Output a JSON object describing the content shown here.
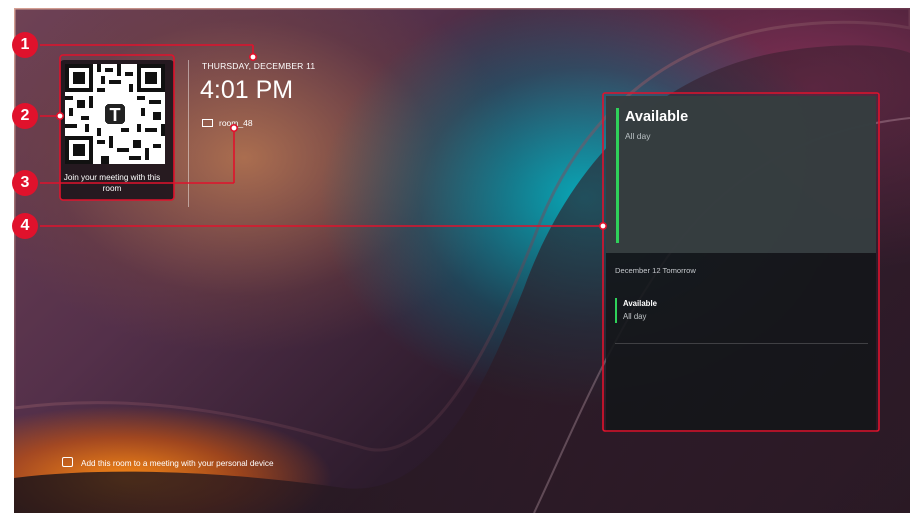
{
  "qr": {
    "caption": "Join your meeting with this room",
    "logo_icon": "teams-logo"
  },
  "clock": {
    "date": "THURSDAY, DECEMBER 11",
    "time": "4:01 PM",
    "room_name": "room_48",
    "room_icon": "display-icon"
  },
  "bottom_hint": {
    "text": "Add this room to a meeting with your personal device",
    "icon": "cast-device-icon"
  },
  "schedule": {
    "today": {
      "title": "Available",
      "subtitle": "All day"
    },
    "tomorrow": {
      "header": "December 12 Tomorrow",
      "title": "Available",
      "subtitle": "All day"
    }
  },
  "annotations": {
    "badge_1": "1",
    "badge_2": "2",
    "badge_3": "3",
    "badge_4": "4",
    "color": "#e0122c"
  },
  "colors": {
    "available": "#2fd15a",
    "panel": "#14161a"
  }
}
